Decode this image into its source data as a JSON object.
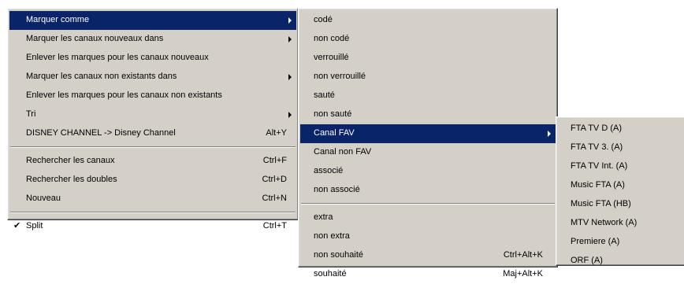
{
  "main_menu": {
    "items": [
      {
        "label": "Marquer comme",
        "shortcut": ""
      },
      {
        "label": "Marquer les canaux nouveaux dans",
        "shortcut": ""
      },
      {
        "label": "Enlever les marques pour les canaux nouveaux",
        "shortcut": ""
      },
      {
        "label": "Marquer les canaux non existants dans",
        "shortcut": ""
      },
      {
        "label": "Enlever les marques pour les canaux non existants",
        "shortcut": ""
      },
      {
        "label": "Tri",
        "shortcut": ""
      },
      {
        "label": "DISNEY CHANNEL -> Disney Channel",
        "shortcut": "Alt+Y"
      },
      {
        "label": "Rechercher les canaux",
        "shortcut": "Ctrl+F"
      },
      {
        "label": "Rechercher les doubles",
        "shortcut": "Ctrl+D"
      },
      {
        "label": "Nouveau",
        "shortcut": "Ctrl+N"
      },
      {
        "label": "Split",
        "shortcut": "Ctrl+T",
        "check": "✔"
      }
    ]
  },
  "submenu_marquer": {
    "items": [
      {
        "label": "codé"
      },
      {
        "label": "non codé"
      },
      {
        "label": "verrouillé"
      },
      {
        "label": "non verrouillé"
      },
      {
        "label": "sauté"
      },
      {
        "label": "non sauté"
      },
      {
        "label": "Canal FAV"
      },
      {
        "label": "Canal non FAV"
      },
      {
        "label": "associé"
      },
      {
        "label": "non associé"
      },
      {
        "label": "extra"
      },
      {
        "label": "non extra"
      },
      {
        "label": "non souhaité",
        "shortcut": "Ctrl+Alt+K"
      },
      {
        "label": "souhaité",
        "shortcut": "Maj+Alt+K"
      }
    ]
  },
  "submenu_fav": {
    "items": [
      {
        "label": "FTA TV D (A)"
      },
      {
        "label": "FTA TV 3. (A)"
      },
      {
        "label": "FTA TV Int. (A)"
      },
      {
        "label": "Music FTA (A)"
      },
      {
        "label": "Music FTA (HB)"
      },
      {
        "label": "MTV Network (A)"
      },
      {
        "label": "Premiere (A)"
      },
      {
        "label": "ORF (A)"
      }
    ]
  },
  "colors": {
    "menu_bg": "#d4d0c8",
    "highlight": "#0a246a",
    "highlight_text": "#ffffff"
  }
}
